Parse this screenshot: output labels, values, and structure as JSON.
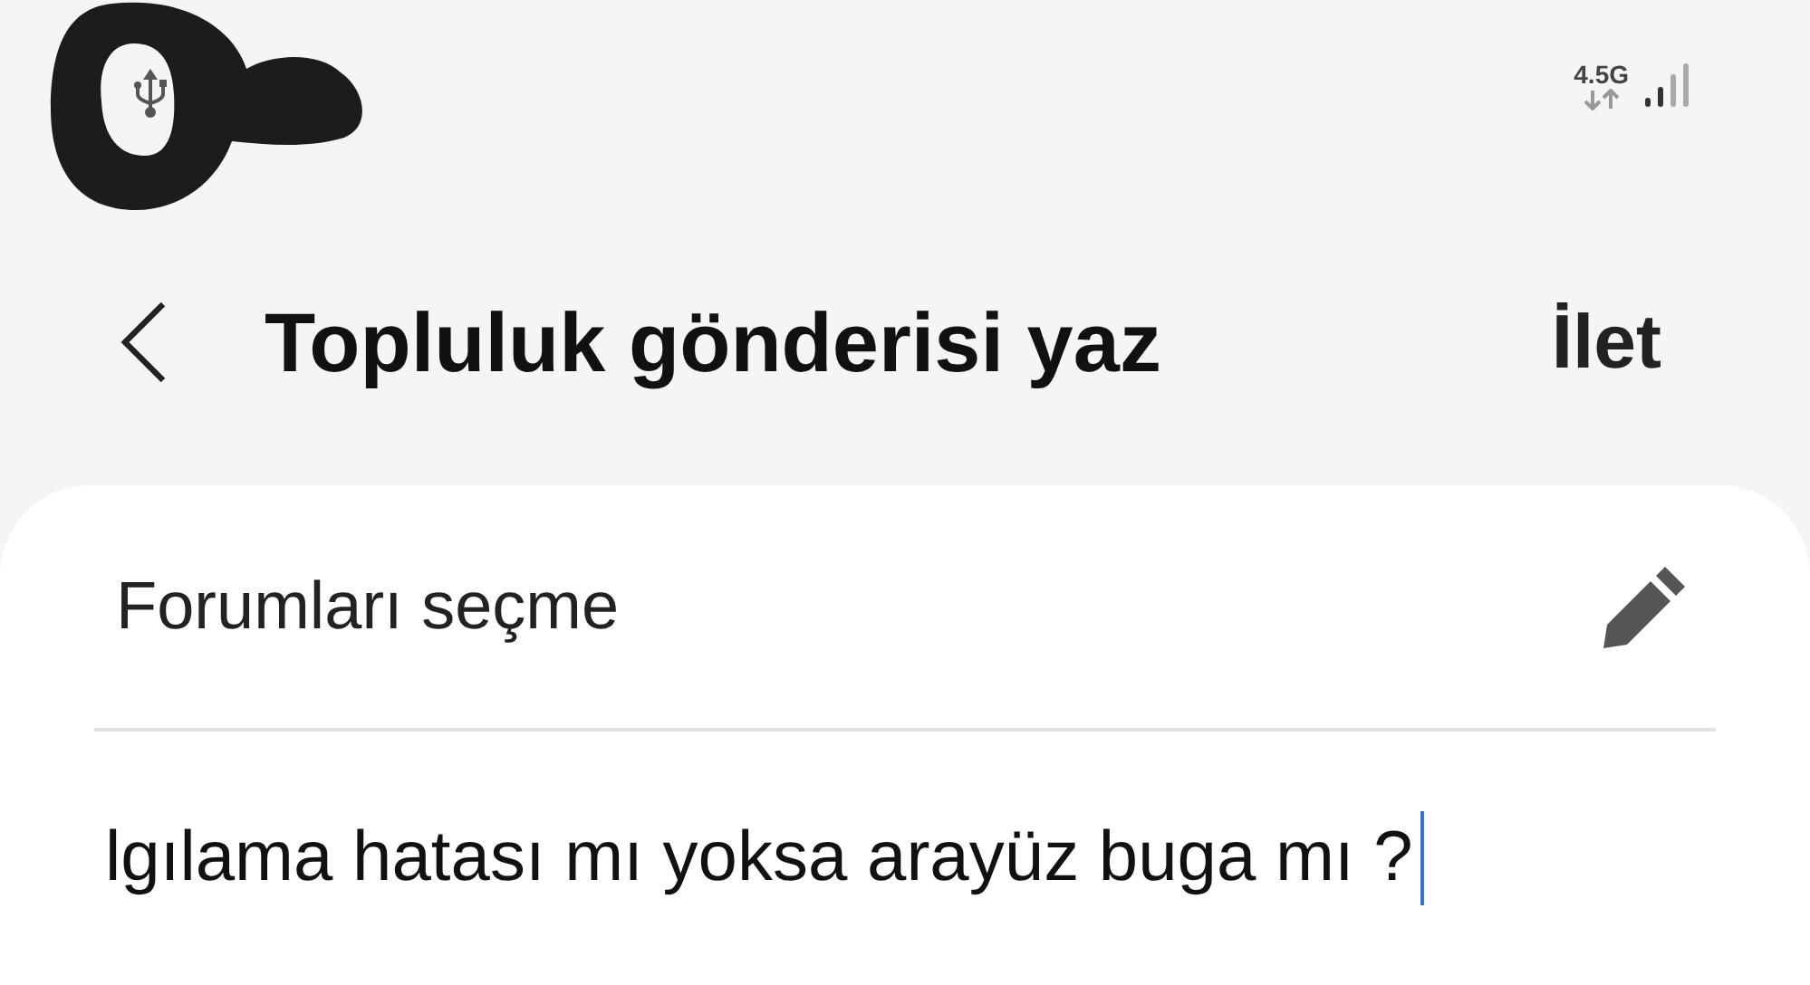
{
  "status_bar": {
    "network_type": "4.5G"
  },
  "header": {
    "title": "Topluluk gönderisi yaz",
    "action": "İlet"
  },
  "form": {
    "forum_picker": {
      "label": "Forumları seçme"
    },
    "post_text": {
      "value": "lgılama hatası mı yoksa arayüz buga mı ?"
    }
  }
}
